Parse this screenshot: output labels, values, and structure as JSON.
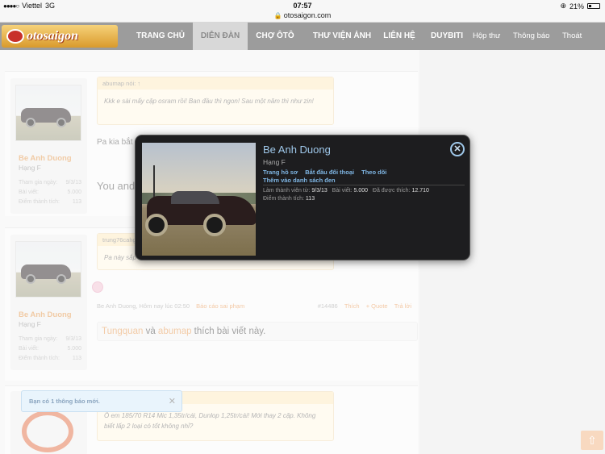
{
  "status": {
    "carrier": "Viettel",
    "network": "3G",
    "time": "07:57",
    "battery": "21%"
  },
  "url": "otosaigon.com",
  "nav": {
    "logo": "otosaigon",
    "items": [
      "TRANG CHỦ",
      "DIỄN ĐÀN",
      "CHỢ ÔTÔ",
      "THƯ VIỆN ẢNH",
      "LIÊN HỆ",
      "DUYBITI"
    ],
    "small": [
      "Hộp thư",
      "Thông báo",
      "Thoát"
    ]
  },
  "posts": [
    {
      "user": {
        "name": "Be Anh Duong",
        "rank": "Hạng F",
        "stats": [
          [
            "Tham gia ngày:",
            "9/3/13"
          ],
          [
            "Bài viết:",
            "5.000"
          ],
          [
            "Điểm thành tích:",
            "113"
          ]
        ]
      },
      "quote": {
        "head": "abumap nói: ↑",
        "body": "Kkk e sài mấy cặp osram rồi! Ban đầu thì ngon! Sau một năm thì như zin!"
      },
      "text": "Pa kia bắt",
      "text2": "You and"
    },
    {
      "user": {
        "name": "Be Anh Duong",
        "rank": "Hạng F",
        "stats": [
          [
            "Tham gia ngày:",
            "9/3/13"
          ],
          [
            "Bài viết:",
            "5.000"
          ],
          [
            "Điểm thành tích:",
            "113"
          ]
        ]
      },
      "quote": {
        "head": "trung76cahg",
        "body": "Pa này sắp"
      },
      "meta": {
        "left": "Be Anh Duong, Hôm nay lúc 02:50",
        "report": "Báo cáo sai phạm",
        "num": "#14486",
        "like": "Thích",
        "quote": "+ Quote",
        "reply": "Trả lời"
      },
      "likes": {
        "u1": "Tungquan",
        "and": " và ",
        "u2": "abumap",
        "tail": " thích bài viết này."
      }
    },
    {
      "quote": {
        "body": "Ô em 185/70 R14 Mic 1,35tr/cái, Dunlop 1,25tr/cái! Mới thay 2 cặp. Không biết lấp 2 loại có tốt không nhỉ?"
      }
    }
  ],
  "toast": "Bạn có 1 thông báo mới.",
  "popup": {
    "name": "Be Anh Duong",
    "rank": "Hạng F",
    "links": [
      "Trang hồ sơ",
      "Bắt đầu đối thoại",
      "Theo dõi"
    ],
    "link2": "Thêm vào danh sách đen",
    "joined_label": "Làm thành viên từ:",
    "joined": "9/3/13",
    "posts_label": "Bài viết:",
    "posts": "5.000",
    "likes_label": "Đã được thích:",
    "likes": "12.710",
    "points_label": "Điểm thành tích:",
    "points": "113"
  }
}
